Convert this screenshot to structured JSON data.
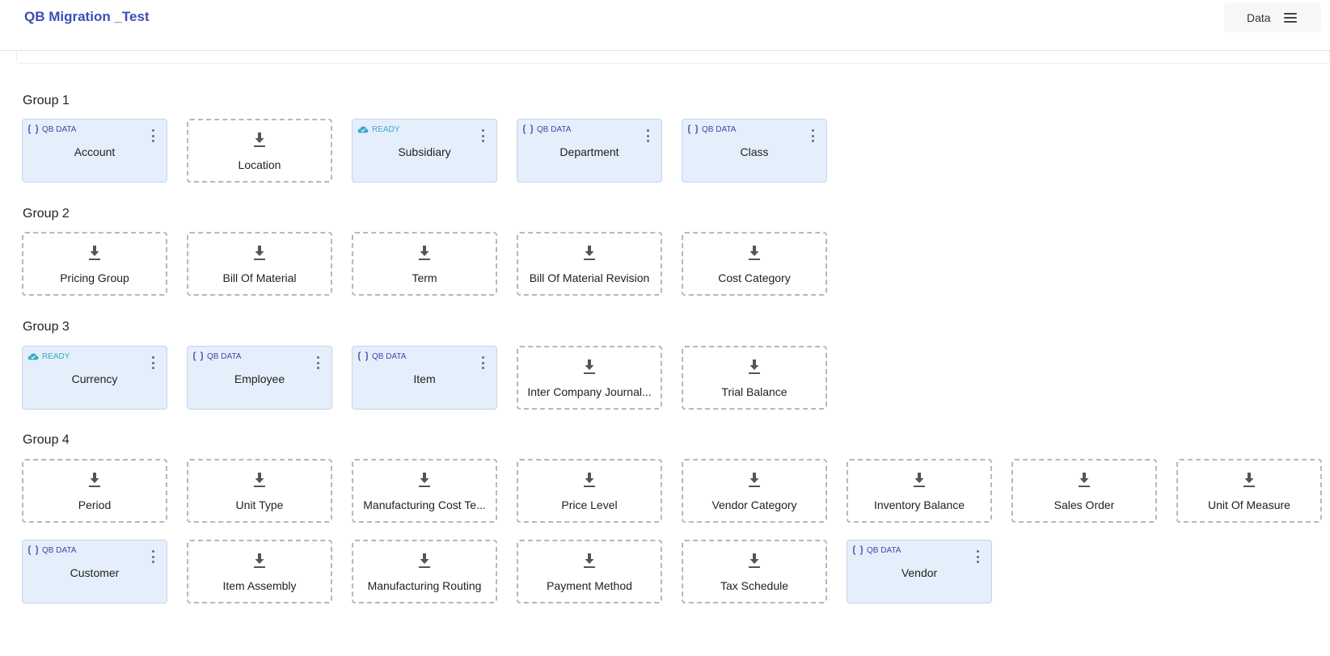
{
  "app": {
    "title": "QB Migration _Test"
  },
  "header": {
    "data_label": "Data",
    "menu_icon": "hamburger-menu-icon"
  },
  "badges": {
    "qb": "QB DATA",
    "ready": "READY"
  },
  "groups": [
    {
      "title": "Group 1",
      "cards": [
        {
          "name": "Account",
          "status": "qb"
        },
        {
          "name": "Location",
          "status": "empty"
        },
        {
          "name": "Subsidiary",
          "status": "ready"
        },
        {
          "name": "Department",
          "status": "qb"
        },
        {
          "name": "Class",
          "status": "qb"
        }
      ]
    },
    {
      "title": "Group 2",
      "cards": [
        {
          "name": "Pricing Group",
          "status": "empty"
        },
        {
          "name": "Bill Of Material",
          "status": "empty"
        },
        {
          "name": "Term",
          "status": "empty"
        },
        {
          "name": "Bill Of Material Revision",
          "status": "empty"
        },
        {
          "name": "Cost Category",
          "status": "empty"
        }
      ]
    },
    {
      "title": "Group 3",
      "cards": [
        {
          "name": "Currency",
          "status": "ready"
        },
        {
          "name": "Employee",
          "status": "qb"
        },
        {
          "name": "Item",
          "status": "qb"
        },
        {
          "name": "Inter Company Journal...",
          "status": "empty"
        },
        {
          "name": "Trial Balance",
          "status": "empty"
        }
      ]
    },
    {
      "title": "Group 4",
      "cards": [
        {
          "name": "Period",
          "status": "empty"
        },
        {
          "name": "Unit Type",
          "status": "empty"
        },
        {
          "name": "Manufacturing Cost Te...",
          "status": "empty"
        },
        {
          "name": "Price Level",
          "status": "empty"
        },
        {
          "name": "Vendor Category",
          "status": "empty"
        },
        {
          "name": "Inventory Balance",
          "status": "empty"
        },
        {
          "name": "Sales Order",
          "status": "empty"
        },
        {
          "name": "Unit Of Measure",
          "status": "empty"
        },
        {
          "name": "Customer",
          "status": "qb"
        },
        {
          "name": "Item Assembly",
          "status": "empty"
        },
        {
          "name": "Manufacturing Routing",
          "status": "empty"
        },
        {
          "name": "Payment Method",
          "status": "empty"
        },
        {
          "name": "Tax Schedule",
          "status": "empty"
        },
        {
          "name": "Vendor",
          "status": "qb"
        }
      ]
    }
  ]
}
